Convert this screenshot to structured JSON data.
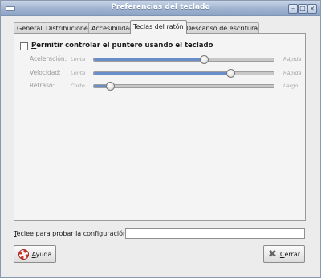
{
  "window": {
    "title": "Preferencias del teclado"
  },
  "tabs": [
    {
      "label": "General"
    },
    {
      "label": "Distribuciones"
    },
    {
      "label": "Accesibilidad"
    },
    {
      "label": "Teclas del ratón",
      "selected": true
    },
    {
      "label": "Descanso de escritura"
    }
  ],
  "mouse_keys": {
    "checkbox_label_mnemonic": "P",
    "checkbox_label_rest": "ermitir controlar el puntero usando el teclado",
    "checked": false,
    "rows": [
      {
        "label": "Aceleración:",
        "low": "Lenta",
        "high": "Rápida",
        "value_fraction": 0.61,
        "enabled": false
      },
      {
        "label": "Velocidad:",
        "low": "Lenta",
        "high": "Rápida",
        "value_fraction": 0.76,
        "enabled": false
      },
      {
        "label": "Retraso:",
        "low": "Corto",
        "high": "Largo",
        "value_fraction": 0.09,
        "enabled": false
      }
    ]
  },
  "test": {
    "label_mnemonic": "T",
    "label_rest": "eclee para probar la configuración:",
    "value": ""
  },
  "buttons": {
    "help_mnemonic": "A",
    "help_rest": "yuda",
    "close_mnemonic": "C",
    "close_rest": "errar"
  },
  "icons": {
    "help": "lifebuoy-icon",
    "close": "close-x-icon"
  }
}
